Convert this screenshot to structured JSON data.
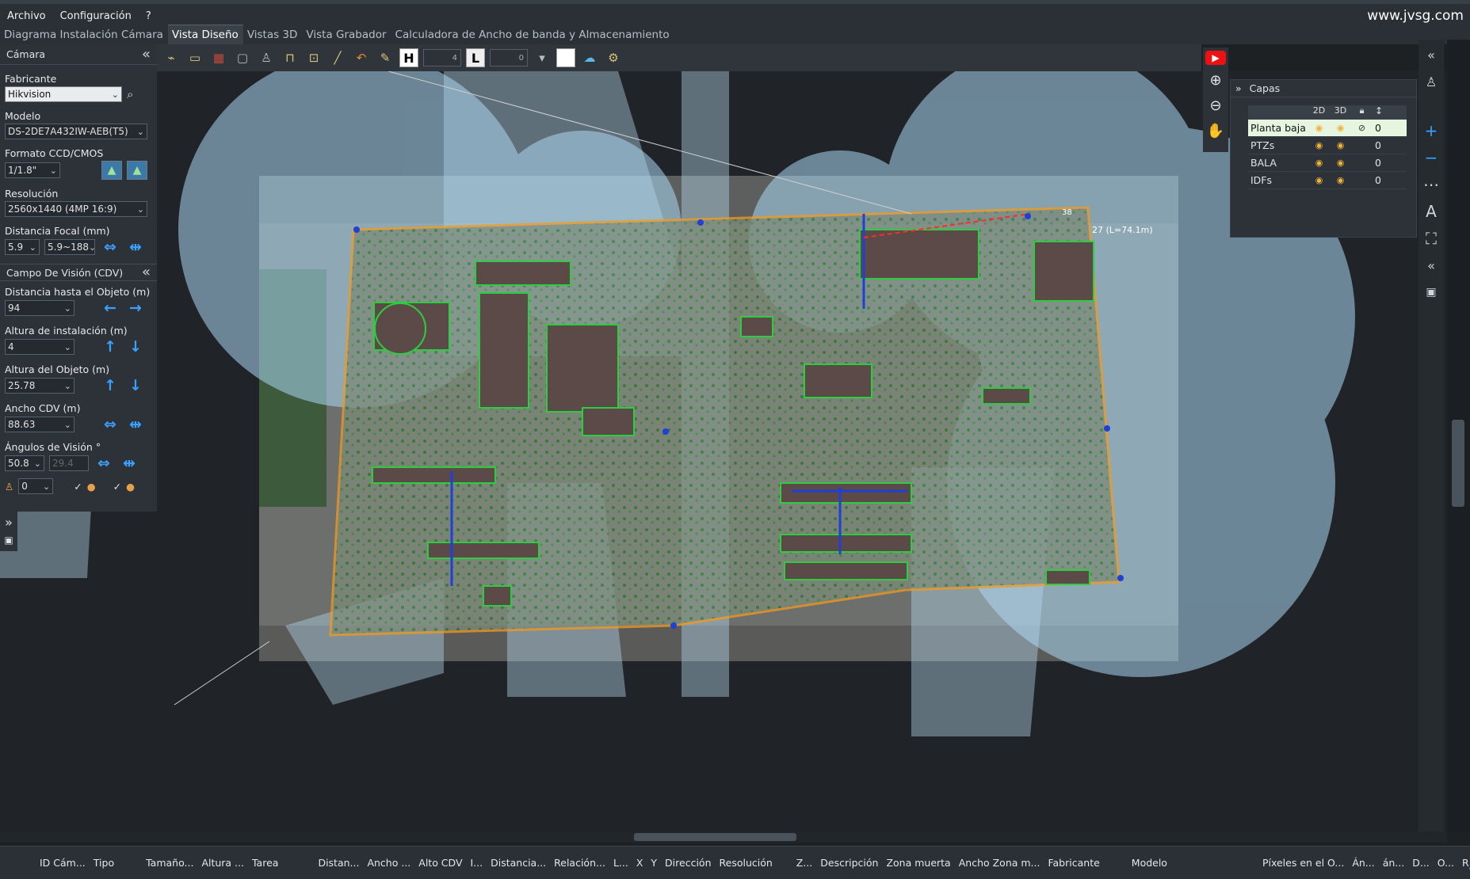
{
  "menu": {
    "items": [
      "Archivo",
      "Configuración",
      "?"
    ],
    "brand": "www.jvsg.com"
  },
  "tabs": [
    {
      "label": "Diagrama Instalación Cámara"
    },
    {
      "label": "Vista Diseño"
    },
    {
      "label": "Vistas 3D"
    },
    {
      "label": "Vista Grabador"
    },
    {
      "label": "Calculadora de Ancho de banda y Almacenamiento"
    }
  ],
  "camera_panel": {
    "title": "Cámara",
    "manufacturer_label": "Fabricante",
    "manufacturer_value": "Hikvision",
    "model_label": "Modelo",
    "model_value": "DS-2DE7A432IW-AEB(T5)",
    "format_label": "Formato CCD/CMOS",
    "format_value": "1/1.8\"",
    "resolution_label": "Resolución",
    "resolution_value": "2560x1440 (4MP 16:9)",
    "focal_label": "Distancia Focal (mm)",
    "focal_value": "5.9",
    "focal_range": "5.9~188"
  },
  "fov_panel": {
    "title": "Campo De Visión (CDV)",
    "distance_label": "Distancia hasta el Objeto (m)",
    "distance_value": "94",
    "install_height_label": "Altura de instalación (m)",
    "install_height_value": "4",
    "object_height_label": "Altura del Objeto (m)",
    "object_height_value": "25.78",
    "fov_width_label": "Ancho CDV (m)",
    "fov_width_value": "88.63",
    "angles_label": "Ángulos de Visión °",
    "angle_h": "50.8",
    "angle_v": "29.4",
    "person_value": "0"
  },
  "toolbar": {
    "h_value": "4",
    "l_value": "0"
  },
  "canvas": {
    "measure_label": "27 (L=74.1m)",
    "small_label": "38"
  },
  "layers": {
    "title": "Capas",
    "columns": [
      "2D",
      "3D"
    ],
    "rows": [
      {
        "name": "Planta baja",
        "value": "0"
      },
      {
        "name": "PTZs",
        "value": "0"
      },
      {
        "name": "BALA",
        "value": "0"
      },
      {
        "name": "IDFs",
        "value": "0"
      }
    ]
  },
  "table_columns": [
    "ID Cám...",
    "Tipo",
    "Tamaño...",
    "Altura ...",
    "Tarea",
    "Distan...",
    "Ancho ...",
    "Alto CDV",
    "I...",
    "Distancia...",
    "Relación...",
    "L...",
    "X",
    "Y",
    "Dirección",
    "Resolución",
    "Z...",
    "Descripción",
    "Zona muerta",
    "Ancho Zona m...",
    "Fabricante",
    "Modelo",
    "Píxeles en el O...",
    "Án...",
    "án...",
    "D...",
    "O...",
    "R"
  ],
  "colors": {
    "accent": "#3aa0ff",
    "fov_fill": "#9fd3f0",
    "site_outline": "#f39a1e",
    "building_outline": "#2ecc40"
  }
}
